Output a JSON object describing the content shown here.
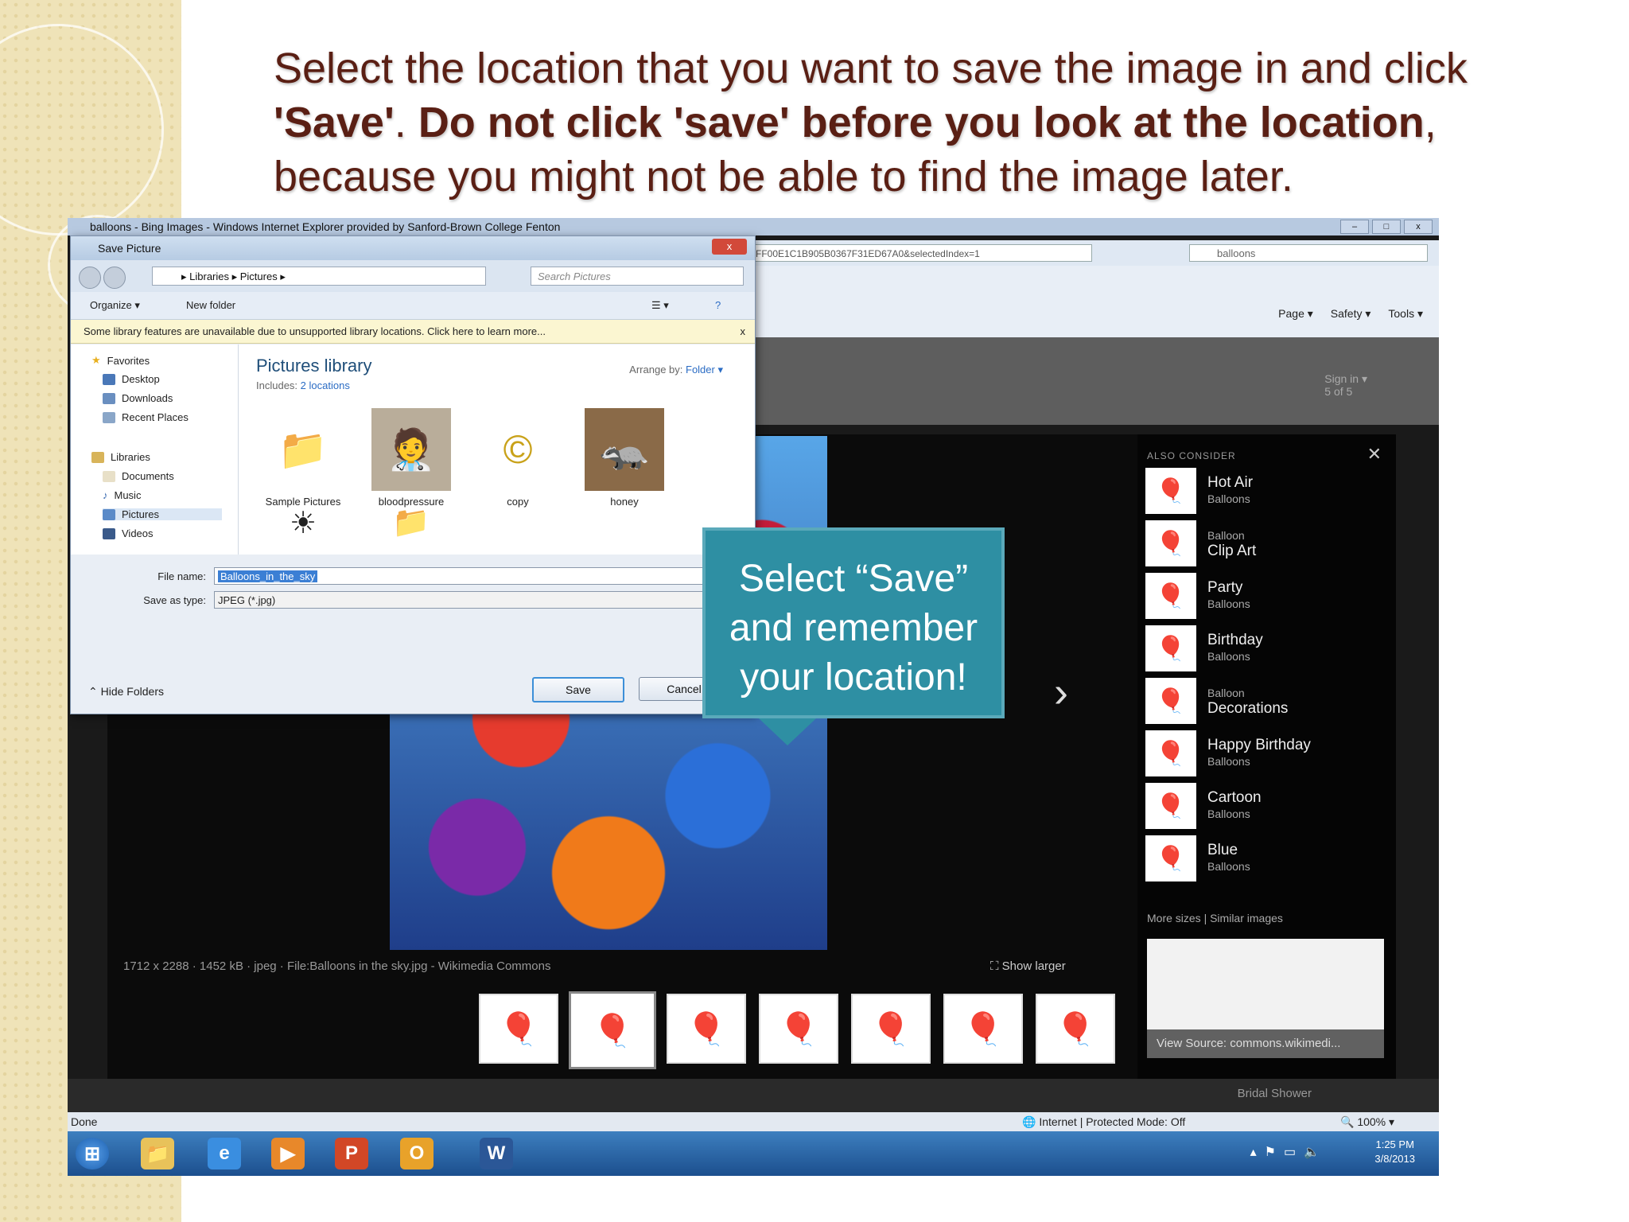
{
  "slide": {
    "instruction": {
      "part1": "Select the location that you want to save the image in and click ",
      "save_word": "'Save'",
      "part2": ". ",
      "bold_warning": "Do not click 'save' before you look at the location",
      "part3": ", because you might not be able to find the image later."
    },
    "callout": {
      "line1": "Select “Save”",
      "line2": "and remember",
      "line3": "your location!"
    }
  },
  "browser": {
    "title": "balloons - Bing Images - Windows Internet Explorer provided by Sanford-Brown College Fenton",
    "address_fragment": "FF00E1C1B905B0367F31ED67A0&selectedIndex=1",
    "search_value": "balloons",
    "commands": [
      "Page ▾",
      "Safety ▾",
      "Tools ▾"
    ],
    "signin": "Sign in ▾",
    "signin_count": "5 of 5",
    "image_meta": "1712 x 2288 · 1452 kB · jpeg · File:Balloons in the sky.jpg - Wikimedia Commons",
    "show_larger": "Show larger",
    "panel": {
      "header": "ALSO CONSIDER",
      "items": [
        {
          "title": "Hot Air",
          "sub": "Balloons"
        },
        {
          "title": "Clip Art",
          "sub": "Balloon",
          "sub_first": true
        },
        {
          "title": "Party",
          "sub": "Balloons"
        },
        {
          "title": "Birthday",
          "sub": "Balloons"
        },
        {
          "title": "Decorations",
          "sub": "Balloon",
          "sub_first": true
        },
        {
          "title": "Happy Birthday",
          "sub": "Balloons"
        },
        {
          "title": "Cartoon",
          "sub": "Balloons"
        },
        {
          "title": "Blue",
          "sub": "Balloons"
        }
      ],
      "more": "More sizes | Similar images",
      "view_source": "View Source: commons.wikimedi..."
    },
    "bottom_label": "Bridal Shower",
    "status_left": "Done",
    "status_zone": "Internet | Protected Mode: Off",
    "status_zoom": "100%",
    "clock_time": "1:25 PM",
    "clock_date": "3/8/2013"
  },
  "dialog": {
    "title": "Save Picture",
    "breadcrumb": "▸ Libraries ▸ Pictures ▸",
    "search_placeholder": "Search Pictures",
    "toolbar": {
      "organize": "Organize ▾",
      "new_folder": "New folder"
    },
    "infobar": "Some library features are unavailable due to unsupported library locations. Click here to learn more...",
    "nav": {
      "favorites": "Favorites",
      "desktop": "Desktop",
      "downloads": "Downloads",
      "recent": "Recent Places",
      "libraries": "Libraries",
      "documents": "Documents",
      "music": "Music",
      "pictures": "Pictures",
      "videos": "Videos"
    },
    "library": {
      "title": "Pictures library",
      "includes": "Includes:",
      "locations": "2 locations",
      "arrange_label": "Arrange by:",
      "arrange_value": "Folder ▾",
      "items": [
        "Sample Pictures",
        "bloodpressure",
        "copy",
        "honey"
      ]
    },
    "file_name_label": "File name:",
    "file_name_value": "Balloons_in_the_sky",
    "save_type_label": "Save as type:",
    "save_type_value": "JPEG (*.jpg)",
    "hide_folders": "Hide Folders",
    "save_button": "Save",
    "cancel_button": "Cancel"
  }
}
